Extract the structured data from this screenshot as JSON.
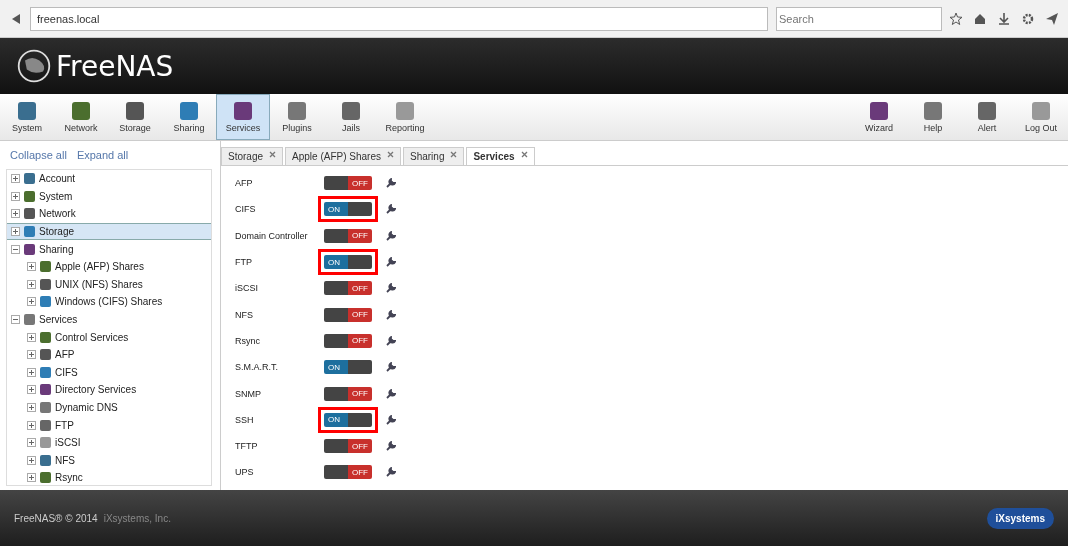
{
  "browser": {
    "url": "freenas.local",
    "search_placeholder": "Search"
  },
  "header": {
    "logo": "FreeNAS"
  },
  "toolbar": {
    "left": [
      {
        "label": "System",
        "selected": false
      },
      {
        "label": "Network",
        "selected": false
      },
      {
        "label": "Storage",
        "selected": false
      },
      {
        "label": "Sharing",
        "selected": false
      },
      {
        "label": "Services",
        "selected": true
      },
      {
        "label": "Plugins",
        "selected": false
      },
      {
        "label": "Jails",
        "selected": false
      },
      {
        "label": "Reporting",
        "selected": false
      }
    ],
    "right": [
      {
        "label": "Wizard"
      },
      {
        "label": "Help"
      },
      {
        "label": "Alert"
      },
      {
        "label": "Log Out"
      }
    ]
  },
  "sidebar": {
    "links": [
      "Collapse all",
      "Expand all"
    ],
    "items": [
      {
        "label": "Account",
        "selected": false,
        "expanded": false
      },
      {
        "label": "System",
        "selected": false,
        "expanded": false
      },
      {
        "label": "Network",
        "selected": false,
        "expanded": false
      },
      {
        "label": "Storage",
        "selected": true,
        "expanded": false
      },
      {
        "label": "Sharing",
        "selected": false,
        "expanded": true,
        "children": [
          {
            "label": "Apple (AFP) Shares",
            "selected": false,
            "expanded": false
          },
          {
            "label": "UNIX (NFS) Shares",
            "selected": false,
            "expanded": false
          },
          {
            "label": "Windows (CIFS) Shares",
            "selected": false,
            "expanded": false
          }
        ]
      },
      {
        "label": "Services",
        "selected": false,
        "expanded": true,
        "children": [
          {
            "label": "Control Services",
            "selected": false,
            "expanded": false
          },
          {
            "label": "AFP",
            "selected": false,
            "expanded": false
          },
          {
            "label": "CIFS",
            "selected": false,
            "expanded": false
          },
          {
            "label": "Directory Services",
            "selected": false,
            "expanded": false
          },
          {
            "label": "Dynamic DNS",
            "selected": false,
            "expanded": false
          },
          {
            "label": "FTP",
            "selected": false,
            "expanded": false
          },
          {
            "label": "iSCSI",
            "selected": false,
            "expanded": false
          },
          {
            "label": "NFS",
            "selected": false,
            "expanded": false
          },
          {
            "label": "Rsync",
            "selected": false,
            "expanded": false
          }
        ]
      }
    ]
  },
  "tabs": [
    {
      "label": "Storage",
      "selected": false
    },
    {
      "label": "Apple (AFP) Shares",
      "selected": false
    },
    {
      "label": "Sharing",
      "selected": false
    },
    {
      "label": "Services",
      "selected": true
    }
  ],
  "services": [
    {
      "name": "AFP",
      "on": false,
      "toggle_text": "OFF",
      "highlighted": false
    },
    {
      "name": "CIFS",
      "on": true,
      "toggle_text": "ON",
      "highlighted": true
    },
    {
      "name": "Domain Controller",
      "on": false,
      "toggle_text": "OFF",
      "highlighted": false
    },
    {
      "name": "FTP",
      "on": true,
      "toggle_text": "ON",
      "highlighted": true
    },
    {
      "name": "iSCSI",
      "on": false,
      "toggle_text": "OFF",
      "highlighted": false
    },
    {
      "name": "NFS",
      "on": false,
      "toggle_text": "OFF",
      "highlighted": false
    },
    {
      "name": "Rsync",
      "on": false,
      "toggle_text": "OFF",
      "highlighted": false
    },
    {
      "name": "S.M.A.R.T.",
      "on": true,
      "toggle_text": "ON",
      "highlighted": false
    },
    {
      "name": "SNMP",
      "on": false,
      "toggle_text": "OFF",
      "highlighted": false
    },
    {
      "name": "SSH",
      "on": true,
      "toggle_text": "ON",
      "highlighted": true
    },
    {
      "name": "TFTP",
      "on": false,
      "toggle_text": "OFF",
      "highlighted": false
    },
    {
      "name": "UPS",
      "on": false,
      "toggle_text": "OFF",
      "highlighted": false
    }
  ],
  "footer": {
    "copyright": "FreeNAS® © 2014",
    "company": "iXsystems, Inc.",
    "logo": "iXsystems"
  }
}
